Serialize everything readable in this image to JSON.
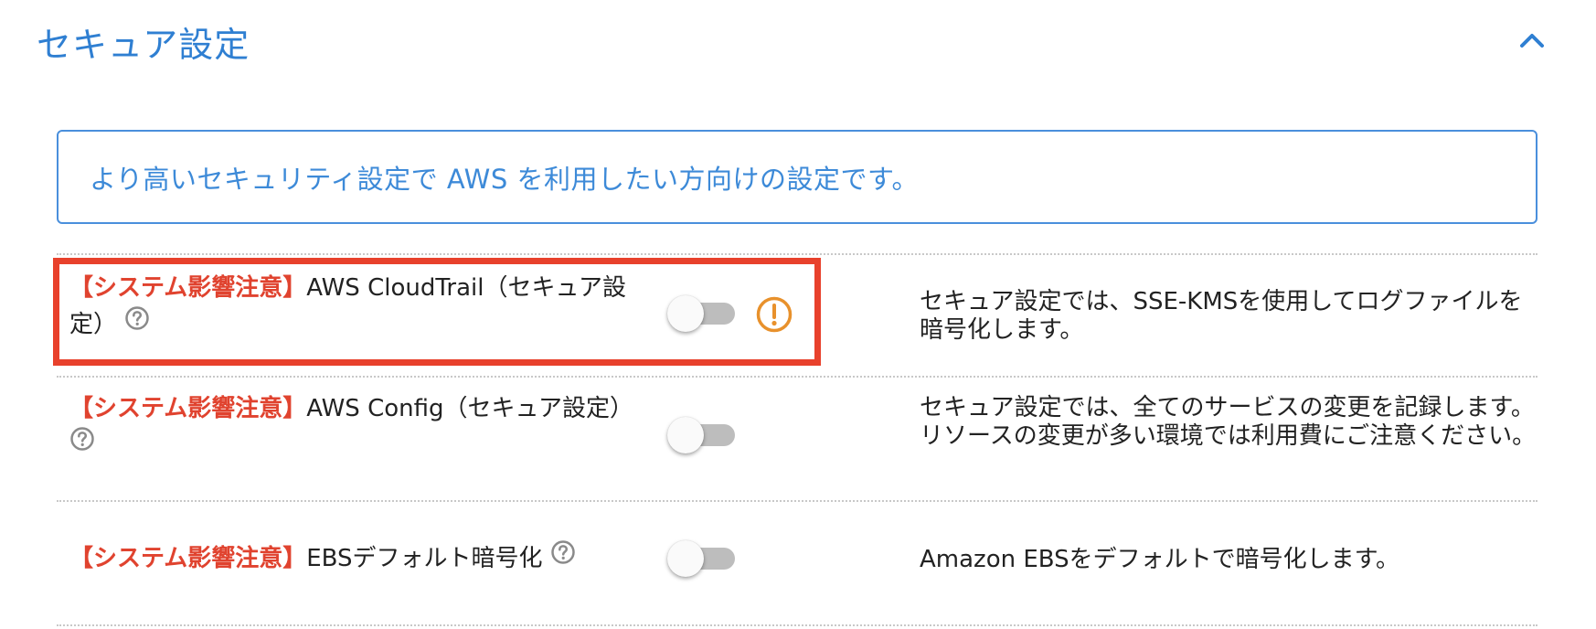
{
  "section": {
    "title": "セキュア設定",
    "collapse_icon": "chevron-up-icon"
  },
  "info": {
    "text": "より高いセキュリティ設定で AWS を利用したい方向けの設定です。"
  },
  "settings": [
    {
      "tag": "【システム影響注意】",
      "label": "AWS CloudTrail（セキュア設定）",
      "enabled": false,
      "warning": true,
      "description": "セキュア設定では、SSE-KMSを使用してログファイルを暗号化します。"
    },
    {
      "tag": "【システム影響注意】",
      "label": "AWS Config（セキュア設定）",
      "enabled": false,
      "warning": false,
      "description": "セキュア設定では、全てのサービスの変更を記録します。リソースの変更が多い環境では利用費にご注意ください。"
    },
    {
      "tag": "【システム影響注意】",
      "label": "EBSデフォルト暗号化",
      "enabled": false,
      "warning": false,
      "description": "Amazon EBSをデフォルトで暗号化します。"
    }
  ],
  "colors": {
    "accent": "#2f7fd2",
    "warning_tag": "#e0432f",
    "highlight_border": "#e8412c",
    "alert_icon": "#e8912c",
    "toggle_off": "#bdbdbd"
  }
}
